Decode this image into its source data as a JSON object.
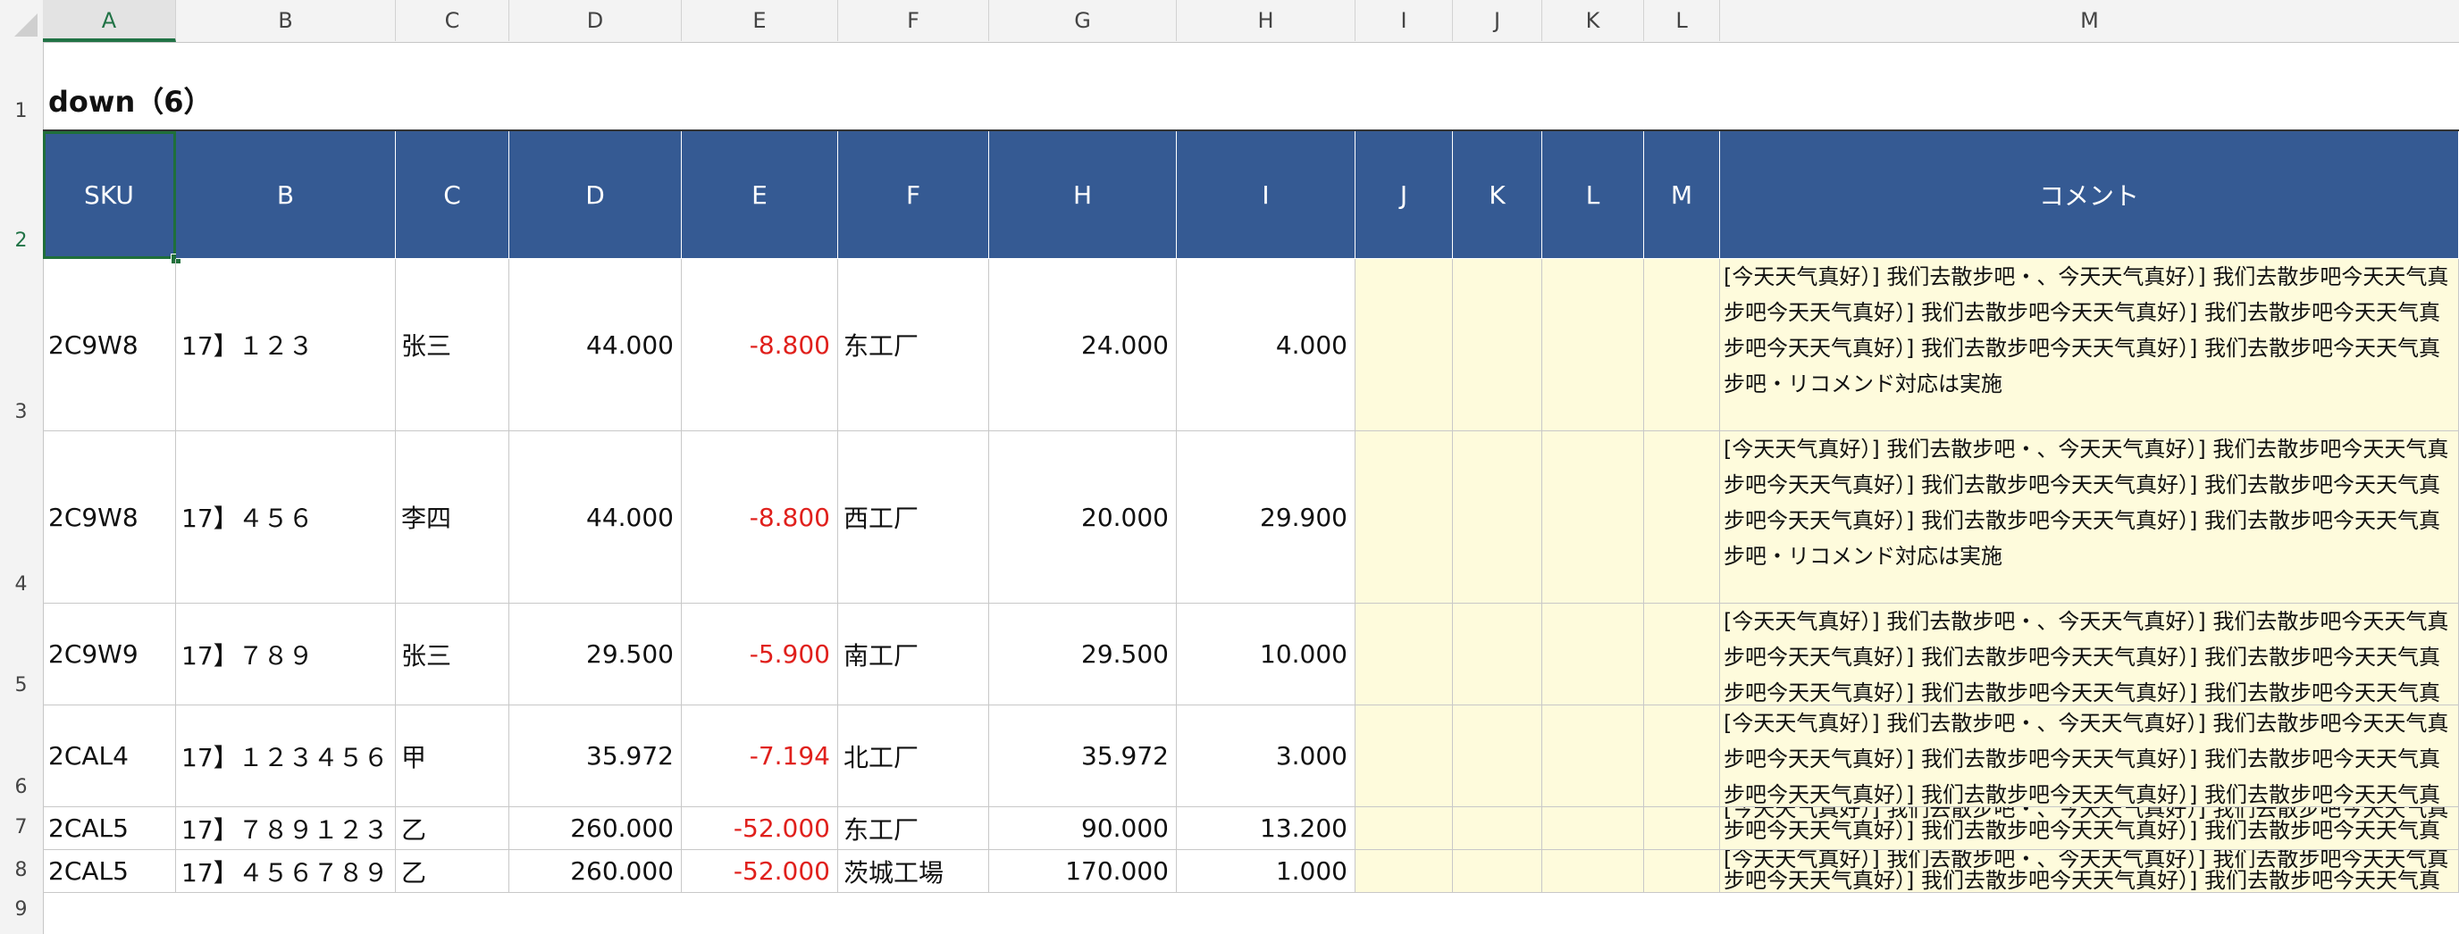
{
  "column_letters": [
    "A",
    "B",
    "C",
    "D",
    "E",
    "F",
    "G",
    "H",
    "I",
    "J",
    "K",
    "L",
    "M"
  ],
  "active_column": "A",
  "row_numbers": [
    "1",
    "2",
    "3",
    "4",
    "5",
    "6",
    "7",
    "8",
    "9"
  ],
  "active_row": "2",
  "title": "down（6）",
  "header_cells": [
    "SKU",
    "B",
    "C",
    "D",
    "E",
    "F",
    "H",
    "I",
    "J",
    "K",
    "L",
    "M",
    "コメント"
  ],
  "rows": [
    {
      "sku": "2C9W8",
      "b": "17】１２３",
      "c": "张三",
      "d": "44.000",
      "e": "-8.800",
      "f": "东工厂",
      "h": "24.000",
      "i": "4.000",
      "comment": [
        "[今天天气真好）] 我们去散步吧・、今天天气真好）] 我们去散步吧今天天气真",
        "步吧今天天气真好）] 我们去散步吧今天天气真好）] 我们去散步吧今天天气真",
        "步吧今天天气真好）] 我们去散步吧今天天气真好）] 我们去散步吧今天天气真",
        "步吧・リコメンド対応は実施"
      ]
    },
    {
      "sku": "2C9W8",
      "b": "17】４５６",
      "c": "李四",
      "d": "44.000",
      "e": "-8.800",
      "f": "西工厂",
      "h": "20.000",
      "i": "29.900",
      "comment": [
        "[今天天气真好）] 我们去散步吧・、今天天气真好）] 我们去散步吧今天天气真",
        "步吧今天天气真好）] 我们去散步吧今天天气真好）] 我们去散步吧今天天气真",
        "步吧今天天气真好）] 我们去散步吧今天天气真好）] 我们去散步吧今天天气真",
        "步吧・リコメンド対応は実施"
      ]
    },
    {
      "sku": "2C9W9",
      "b": "17】７８９",
      "c": "张三",
      "d": "29.500",
      "e": "-5.900",
      "f": "南工厂",
      "h": "29.500",
      "i": "10.000",
      "comment": [
        "[今天天气真好）] 我们去散步吧・、今天天气真好）] 我们去散步吧今天天气真",
        "步吧今天天气真好）] 我们去散步吧今天天气真好）] 我们去散步吧今天天气真",
        "步吧今天天气真好）] 我们去散步吧今天天气真好）] 我们去散步吧今天天气真"
      ]
    },
    {
      "sku": "2CAL4",
      "b": "17】１２３４５６",
      "c": "甲",
      "d": "35.972",
      "e": "-7.194",
      "f": "北工厂",
      "h": "35.972",
      "i": "3.000",
      "comment": [
        "[今天天气真好）] 我们去散步吧・、今天天气真好）] 我们去散步吧今天天气真",
        "步吧今天天气真好）] 我们去散步吧今天天气真好）] 我们去散步吧今天天气真",
        "步吧今天天气真好）] 我们去散步吧今天天气真好）] 我们去散步吧今天天气真"
      ]
    },
    {
      "sku": "2CAL5",
      "b": "17】７８９１２３",
      "c": "乙",
      "d": "260.000",
      "e": "-52.000",
      "f": "东工厂",
      "h": "90.000",
      "i": "13.200",
      "comment": [
        "[今天天气真好）] 我们去散步吧・、今天天气真好）] 我们去散步吧今天天气真",
        "步吧今天天气真好）] 我们去散步吧今天天气真好）] 我们去散步吧今天天气真"
      ]
    },
    {
      "sku": "2CAL5",
      "b": "17】４５６７８９",
      "c": "乙",
      "d": "260.000",
      "e": "-52.000",
      "f": "茨城工場",
      "h": "170.000",
      "i": "1.000",
      "comment": [
        "[今天天气真好）] 我们去散步吧・、今天天气真好）] 我们去散步吧今天天气真",
        "步吧今天天气真好）] 我们去散步吧今天天气真好）] 我们去散步吧今天天气真"
      ]
    }
  ],
  "colors": {
    "header_fill": "#355a93",
    "header_text": "#ffffff",
    "negative": "#e0201c",
    "highlight_fill": "#fefbdc",
    "selection": "#217346"
  }
}
